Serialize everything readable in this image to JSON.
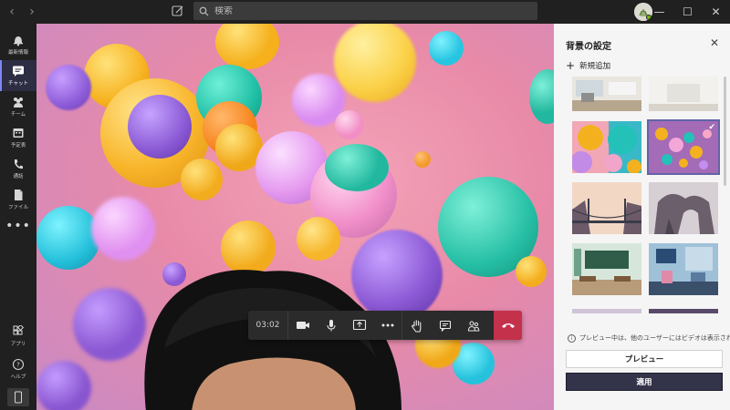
{
  "titlebar": {
    "back_icon": "chevron-left-icon",
    "forward_icon": "chevron-right-icon",
    "search_placeholder": "検索",
    "window_buttons": [
      "—",
      "☐",
      "✕"
    ]
  },
  "rail": {
    "items": [
      {
        "label": "最新情報",
        "icon": "bell-icon"
      },
      {
        "label": "チャット",
        "icon": "chat-icon",
        "active": true
      },
      {
        "label": "チーム",
        "icon": "teams-icon"
      },
      {
        "label": "予定表",
        "icon": "calendar-icon"
      },
      {
        "label": "通話",
        "icon": "phone-icon"
      },
      {
        "label": "ファイル",
        "icon": "file-icon"
      }
    ],
    "more": "•••",
    "apps_label": "アプリ",
    "help_label": "ヘルプ"
  },
  "call": {
    "timer": "03:02",
    "buttons": [
      "camera-icon",
      "mic-icon",
      "share-screen-icon",
      "more-icon",
      "raise-hand-icon",
      "chat-icon",
      "participants-icon",
      "hangup-icon"
    ]
  },
  "panel": {
    "title": "背景の設定",
    "close": "✕",
    "add_new": "新規追加",
    "preview_note": "プレビュー中は、他のユーザーにはビデオは表示されま...",
    "preview_button": "プレビュー",
    "apply_button": "適用"
  },
  "colors": {
    "accent": "#6264a7",
    "hangup": "#c4314b",
    "rail_bg": "#202020",
    "panel_bg": "#f5f5f5"
  }
}
